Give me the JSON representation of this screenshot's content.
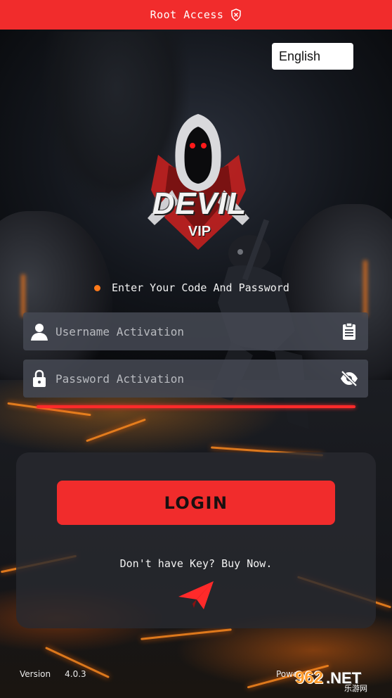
{
  "status_bar": {
    "title": "Root Access",
    "icon": "shield-x-icon"
  },
  "language": {
    "selected": "English"
  },
  "logo": {
    "wordmark": "DEVIL",
    "sub": "VIP"
  },
  "hint": "Enter Your Code And Password",
  "username": {
    "placeholder": "Username Activation",
    "value": "",
    "lead_icon": "user-icon",
    "trail_icon": "clipboard-icon"
  },
  "password": {
    "placeholder": "Password Activation",
    "value": "",
    "lead_icon": "lock-icon",
    "trail_icon": "eye-off-icon"
  },
  "login_label": "LOGIN",
  "buy_text": "Don't have Key? Buy Now.",
  "send_icon": "paper-plane-icon",
  "footer": {
    "version_label": "Version",
    "version": "4.0.3",
    "powered": "Powe"
  },
  "watermark": {
    "digits": "962",
    "suffix": ".NET",
    "cn": "乐游网"
  },
  "colors": {
    "accent": "#f12c2c",
    "hint_dot": "#ff7a1a",
    "field_bg": "#444852",
    "card_bg": "#282a30"
  }
}
